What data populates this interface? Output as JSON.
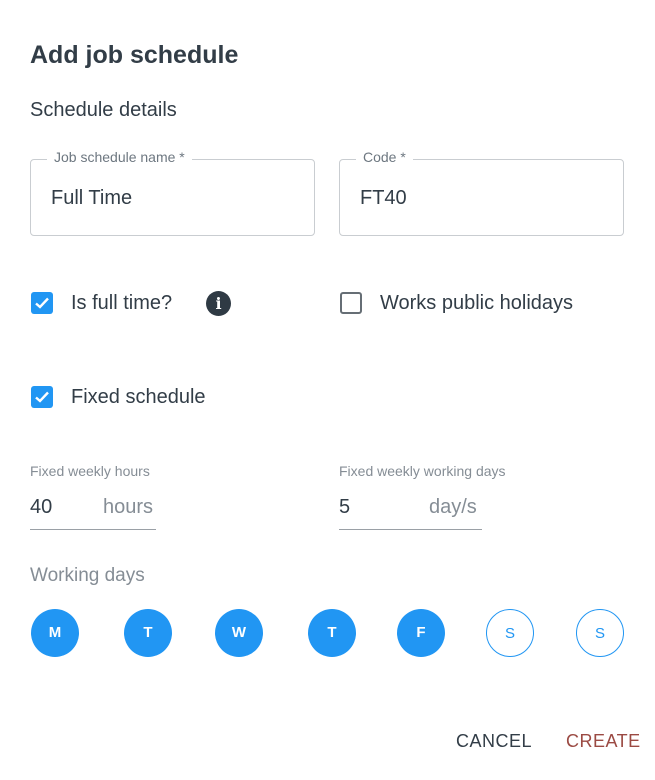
{
  "dialog": {
    "title": "Add job schedule",
    "section_title": "Schedule details"
  },
  "fields": {
    "name": {
      "label": "Job schedule name *",
      "value": "Full Time"
    },
    "code": {
      "label": "Code *",
      "value": "FT40"
    }
  },
  "checkboxes": {
    "full_time": {
      "label": "Is full time?",
      "checked": true,
      "info_icon": "info-icon"
    },
    "public_holidays": {
      "label": "Works public holidays",
      "checked": false
    },
    "fixed_schedule": {
      "label": "Fixed schedule",
      "checked": true
    }
  },
  "weekly": {
    "hours": {
      "label": "Fixed weekly hours",
      "value": "40",
      "unit": "hours"
    },
    "days": {
      "label": "Fixed weekly working days",
      "value": "5",
      "unit": "day/s"
    }
  },
  "working_days": {
    "label": "Working days",
    "days": [
      {
        "letter": "M",
        "selected": true
      },
      {
        "letter": "T",
        "selected": true
      },
      {
        "letter": "W",
        "selected": true
      },
      {
        "letter": "T",
        "selected": true
      },
      {
        "letter": "F",
        "selected": true
      },
      {
        "letter": "S",
        "selected": false
      },
      {
        "letter": "S",
        "selected": false
      }
    ]
  },
  "actions": {
    "cancel": "CANCEL",
    "create": "CREATE"
  },
  "colors": {
    "accent": "#2196f3",
    "danger": "#9b4a43",
    "text": "#323d47"
  }
}
